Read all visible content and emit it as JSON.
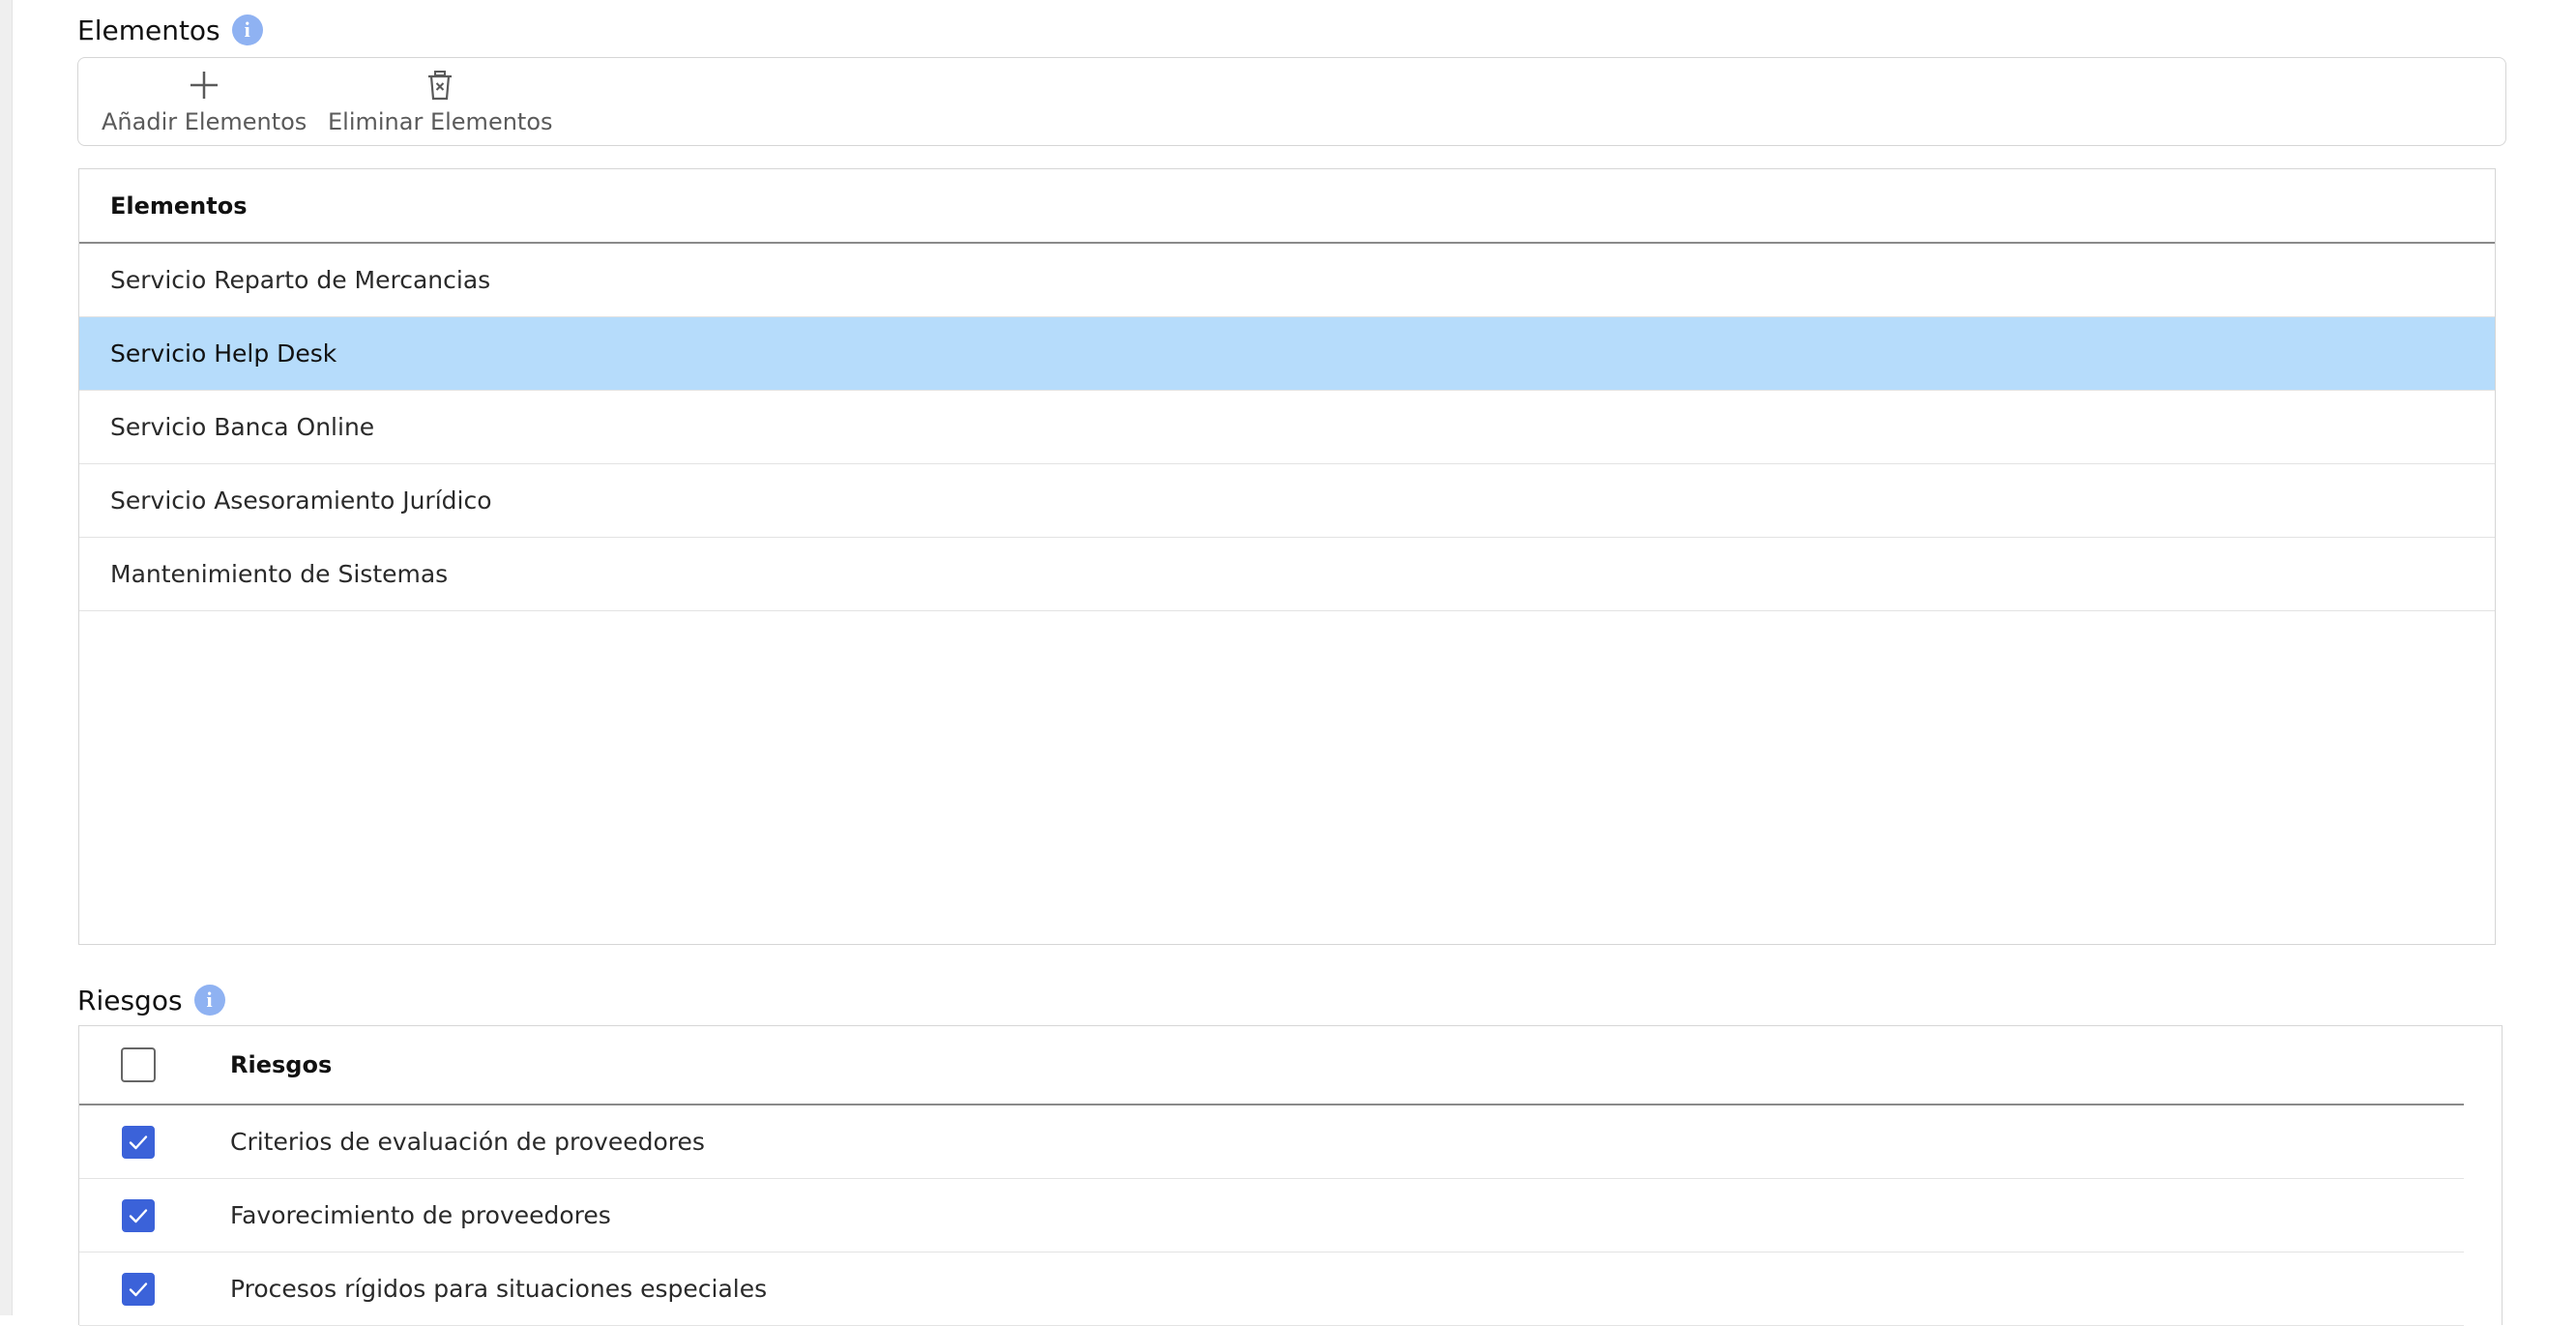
{
  "elements_section": {
    "title": "Elementos",
    "info_icon": "info-icon",
    "toolbar": {
      "add_label": "Añadir Elementos",
      "add_icon": "plus-icon",
      "delete_label": "Eliminar Elementos",
      "delete_icon": "trash-icon"
    },
    "table": {
      "column_header": "Elementos",
      "rows": [
        {
          "label": "Servicio Reparto de Mercancias",
          "selected": false
        },
        {
          "label": "Servicio Help Desk",
          "selected": true
        },
        {
          "label": "Servicio Banca Online",
          "selected": false
        },
        {
          "label": "Servicio Asesoramiento Jurídico",
          "selected": false
        },
        {
          "label": "Mantenimiento de Sistemas",
          "selected": false
        }
      ]
    }
  },
  "risks_section": {
    "title": "Riesgos",
    "info_icon": "info-icon",
    "table": {
      "column_header": "Riesgos",
      "select_all_checked": false,
      "rows": [
        {
          "label": "Criterios de evaluación de proveedores",
          "checked": true
        },
        {
          "label": "Favorecimiento de proveedores",
          "checked": true
        },
        {
          "label": "Procesos rígidos para situaciones especiales",
          "checked": true
        }
      ]
    }
  },
  "colors": {
    "selected_row": "#b6dcfb",
    "checkbox_checked": "#3b62d9",
    "info_icon": "#8fb2f2"
  }
}
